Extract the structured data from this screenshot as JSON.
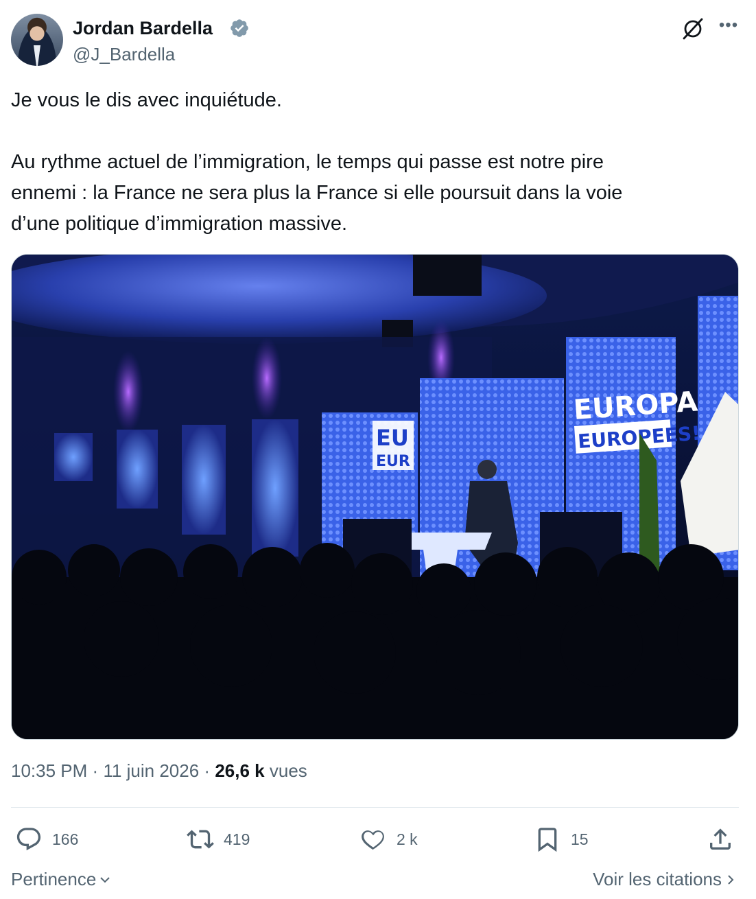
{
  "author": {
    "name": "Jordan Bardella",
    "handle": "@J_Bardella",
    "verified": true
  },
  "tweet": {
    "lines": [
      "Je vous le dis avec inquiétude.",
      "",
      "Au rythme actuel de l’immigration, le temps qui passe est notre pire",
      "ennemi : la France ne sera plus la France si elle poursuit dans la voie",
      "d’une politique d’immigration massive."
    ]
  },
  "media": {
    "banner_text_main": "EUROPA",
    "banner_text_sub": "EUROPEES!",
    "banner_left_main": "EU",
    "banner_left_sub": "EUR"
  },
  "meta": {
    "time": "10:35 PM",
    "separator": "·",
    "date": "11 juin 2026",
    "views_count": "26,6 k",
    "views_label": "vues"
  },
  "actions": {
    "replies": "166",
    "retweets": "419",
    "likes": "2 k",
    "bookmarks": "15"
  },
  "footer": {
    "sort_label": "Pertinence",
    "quotes_label": "Voir les citations"
  },
  "colors": {
    "text": "#0f1419",
    "secondary": "#536471",
    "verified": "#829aab",
    "divider": "#e1e8ed"
  },
  "icons": [
    "verified-badge-icon",
    "grok-icon",
    "more-icon",
    "reply-icon",
    "retweet-icon",
    "like-icon",
    "bookmark-icon",
    "share-icon",
    "chevron-down-icon",
    "chevron-right-icon"
  ]
}
